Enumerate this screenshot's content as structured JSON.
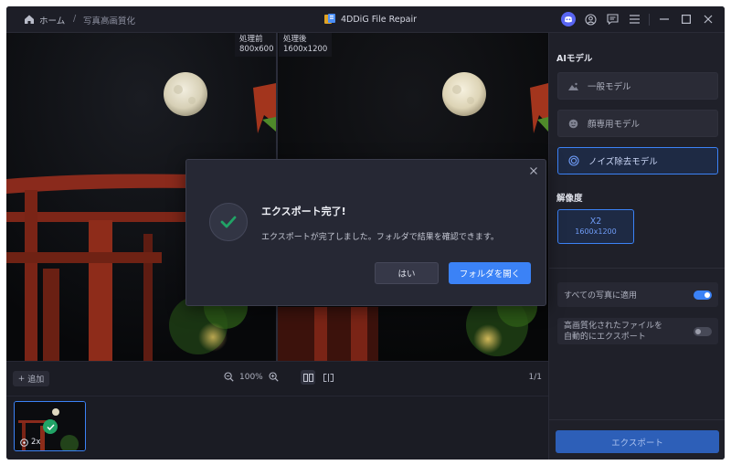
{
  "titlebar": {
    "home_label": "ホーム",
    "separator": "/",
    "page_label": "写真高画質化",
    "app_title": "4DDiG File Repair",
    "icons": [
      "discord-icon",
      "account-icon",
      "feedback-icon",
      "menu-icon",
      "minimize-icon",
      "maximize-icon",
      "close-icon"
    ]
  },
  "preview": {
    "before_label": "処理前",
    "before_size": "800x600",
    "after_label": "処理後",
    "after_size": "1600x1200"
  },
  "toolbar": {
    "add_label": "追加",
    "zoom_value": "100%",
    "page_count": "1/1"
  },
  "thumbnail": {
    "scale_label": "2x"
  },
  "panel": {
    "ai_model_heading": "AIモデル",
    "models": [
      {
        "label": "一般モデル",
        "icon": "landscape-icon",
        "selected": false
      },
      {
        "label": "顔専用モデル",
        "icon": "face-icon",
        "selected": false
      },
      {
        "label": "ノイズ除去モデル",
        "icon": "denoise-icon",
        "selected": true
      }
    ],
    "resolution_heading": "解像度",
    "resolution_scale": "X2",
    "resolution_size": "1600x1200",
    "apply_all_label": "すべての写真に適用",
    "apply_all_on": true,
    "auto_export_line1": "高画質化されたファイルを",
    "auto_export_line2": "自動的にエクスポート",
    "auto_export_on": false,
    "export_label": "エクスポート"
  },
  "modal": {
    "title": "エクスポート完了!",
    "message": "エクスポートが完了しました。フォルダで結果を確認できます。",
    "yes_label": "はい",
    "open_folder_label": "フォルダを開く"
  },
  "colors": {
    "accent": "#3b82f6",
    "background": "#1b1c24",
    "success": "#21a366"
  }
}
